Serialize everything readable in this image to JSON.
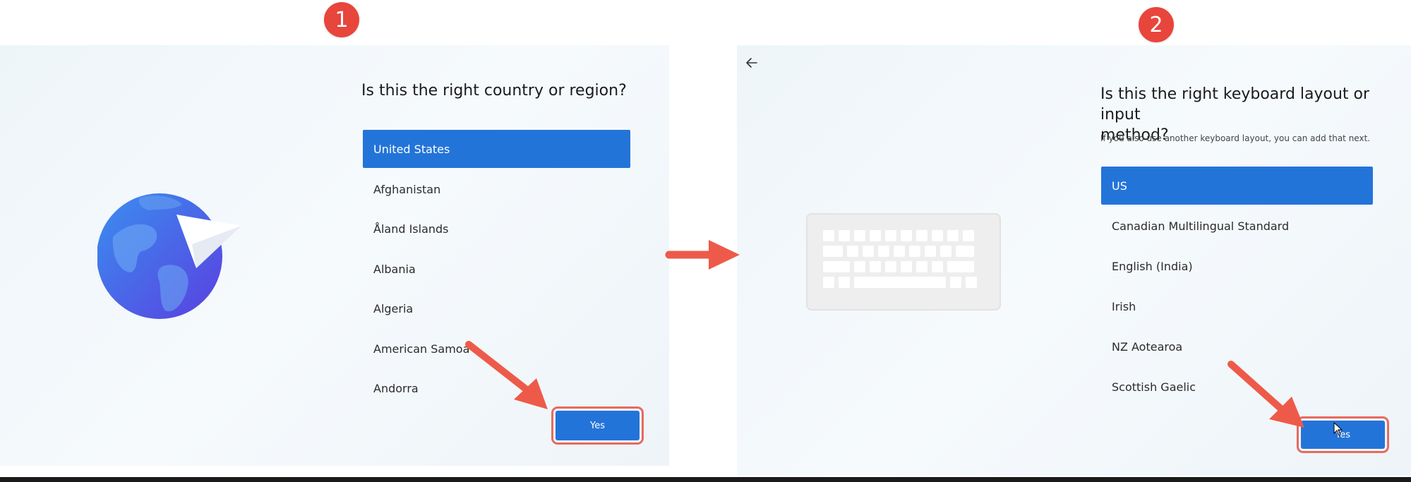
{
  "step1": {
    "badge": "1",
    "heading": "Is this the right country or region?",
    "items": [
      {
        "label": "United States",
        "selected": true
      },
      {
        "label": "Afghanistan",
        "selected": false
      },
      {
        "label": "Åland Islands",
        "selected": false
      },
      {
        "label": "Albania",
        "selected": false
      },
      {
        "label": "Algeria",
        "selected": false
      },
      {
        "label": "American Samoa",
        "selected": false
      },
      {
        "label": "Andorra",
        "selected": false
      }
    ],
    "yes_label": "Yes"
  },
  "step2": {
    "badge": "2",
    "heading_line1": "Is this the right keyboard layout or input",
    "heading_line2": "method?",
    "subtext": "If you also use another keyboard layout, you can add that next.",
    "items": [
      {
        "label": "US",
        "selected": true
      },
      {
        "label": "Canadian Multilingual Standard",
        "selected": false
      },
      {
        "label": "English (India)",
        "selected": false
      },
      {
        "label": "Irish",
        "selected": false
      },
      {
        "label": "NZ Aotearoa",
        "selected": false
      },
      {
        "label": "Scottish Gaelic",
        "selected": false
      }
    ],
    "yes_label": "Yes"
  },
  "colors": {
    "accent": "#2374d9",
    "badge": "#e8453c",
    "highlight_border": "#e86a5f"
  }
}
